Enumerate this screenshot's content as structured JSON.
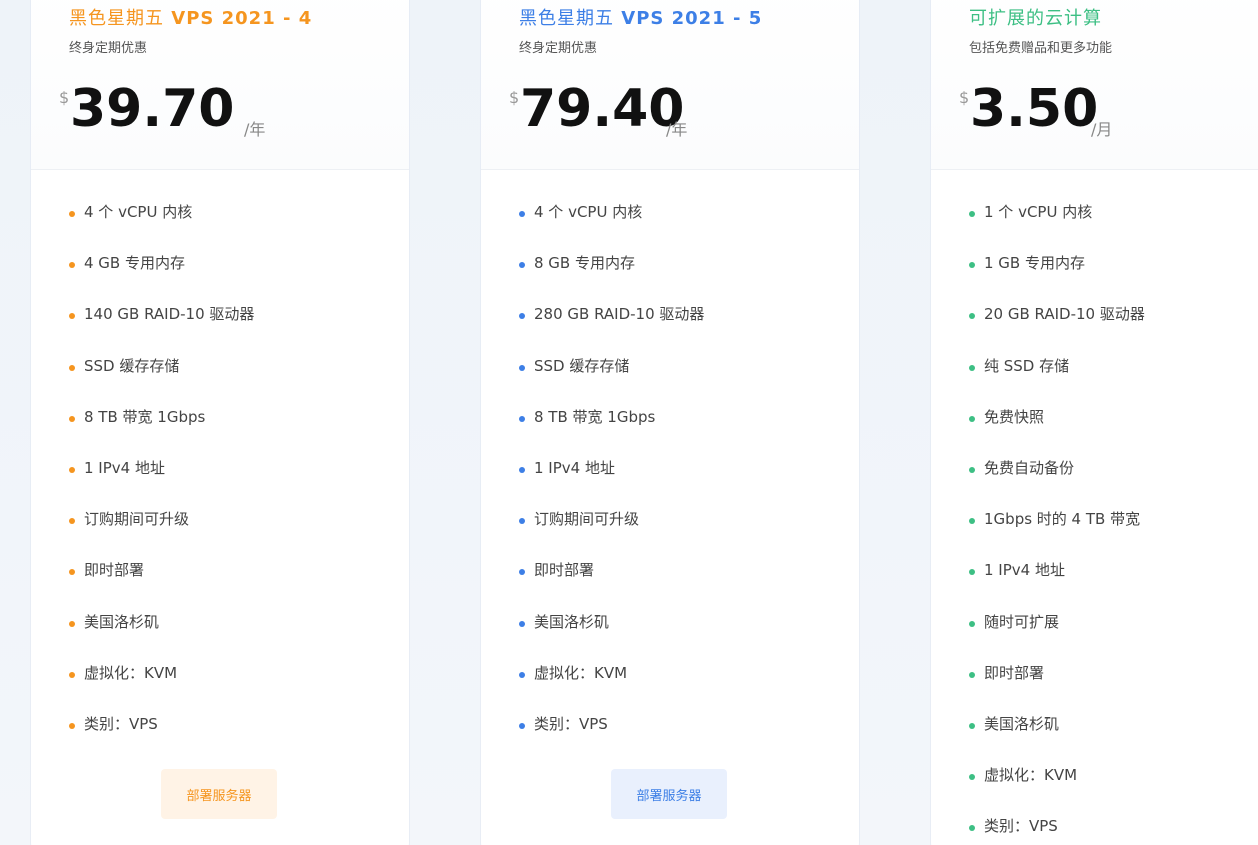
{
  "plans": [
    {
      "title_cn": "黑色星期五",
      "title_en": "VPS 2021 - 4",
      "subtitle": "终身定期优惠",
      "currency": "$",
      "amount": "39.70",
      "period": "/年",
      "accent": "#f5951f",
      "button_label": "部署服务器",
      "button_bg": "#fff3e6",
      "features": [
        "4 个 vCPU 内核",
        "4 GB 专用内存",
        "140 GB RAID-10 驱动器",
        "SSD 缓存存储",
        "8 TB 带宽 1Gbps",
        "1 IPv4 地址",
        "订购期间可升级",
        "即时部署",
        "美国洛杉矶",
        "虚拟化：KVM",
        "类别：VPS"
      ]
    },
    {
      "title_cn": "黑色星期五",
      "title_en": "VPS 2021 - 5",
      "subtitle": "终身定期优惠",
      "currency": "$",
      "amount": "79.40",
      "period": "/年",
      "accent": "#3d7fe6",
      "button_label": "部署服务器",
      "button_bg": "#e9f0fd",
      "features": [
        "4 个 vCPU 内核",
        "8 GB 专用内存",
        "280 GB RAID-10 驱动器",
        "SSD 缓存存储",
        "8 TB 带宽 1Gbps",
        "1 IPv4 地址",
        "订购期间可升级",
        "即时部署",
        "美国洛杉矶",
        "虚拟化：KVM",
        "类别：VPS"
      ]
    },
    {
      "title_cn": "可扩展的云计算",
      "title_en": "",
      "subtitle": "包括免费赠品和更多功能",
      "currency": "$",
      "amount": "3.50",
      "period": "/月",
      "accent": "#3dbf84",
      "features": [
        "1 个 vCPU 内核",
        "1 GB 专用内存",
        "20 GB RAID-10 驱动器",
        "纯 SSD 存储",
        "免费快照",
        "免费自动备份",
        "1Gbps 时的 4 TB 带宽",
        "1 IPv4 地址",
        "随时可扩展",
        "即时部署",
        "美国洛杉矶",
        "虚拟化：KVM",
        "类别：VPS"
      ]
    }
  ]
}
